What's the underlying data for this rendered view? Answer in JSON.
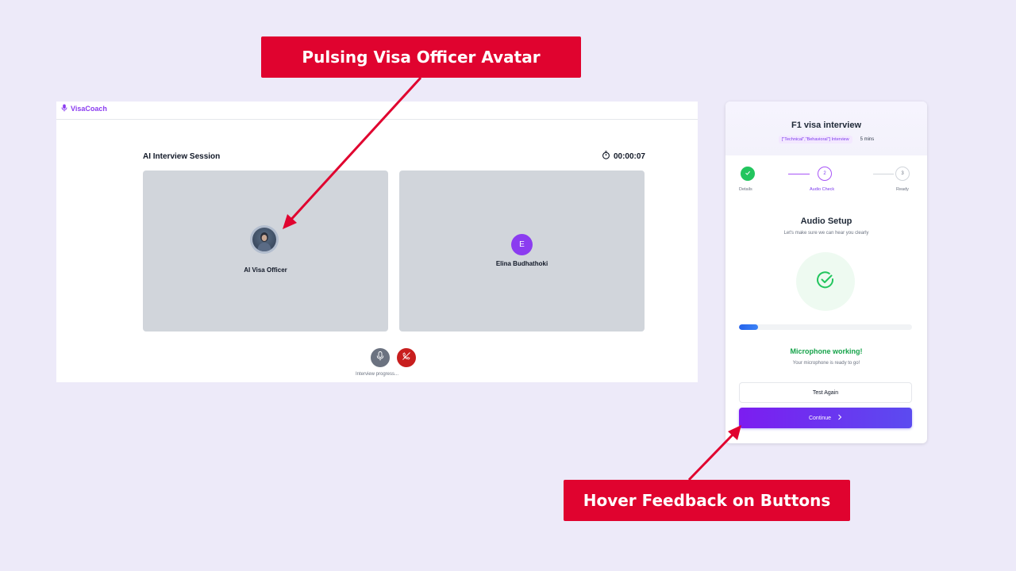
{
  "callouts": {
    "top": "Pulsing Visa Officer Avatar",
    "bottom": "Hover Feedback on Buttons"
  },
  "session": {
    "brand": "VisaCoach",
    "title": "AI Interview Session",
    "timer": "00:00:07",
    "officer_label": "AI Visa Officer",
    "user_initial": "E",
    "user_name": "Elina Budhathoki",
    "progress_note": "Interview progress..."
  },
  "setup": {
    "title": "F1 visa interview",
    "type_badge": "[\"Technical\",\"Behavioral\"] Interview",
    "duration": "5 mins",
    "steps": [
      {
        "number": "1",
        "label": "Details",
        "state": "complete"
      },
      {
        "number": "2",
        "label": "Audio Check",
        "state": "active"
      },
      {
        "number": "3",
        "label": "Ready",
        "state": "pending"
      }
    ],
    "section_title": "Audio Setup",
    "section_subtitle": "Let's make sure we can hear you clearly",
    "mic_level": 0.11,
    "mic_status": "Microphone working!",
    "mic_status_sub": "Your microphone is ready to go!",
    "test_again": "Test Again",
    "continue": "Continue"
  },
  "colors": {
    "callout": "#e0032f",
    "brand": "#8b3cf0",
    "success": "#22c55e",
    "end_call": "#c81e1e"
  }
}
